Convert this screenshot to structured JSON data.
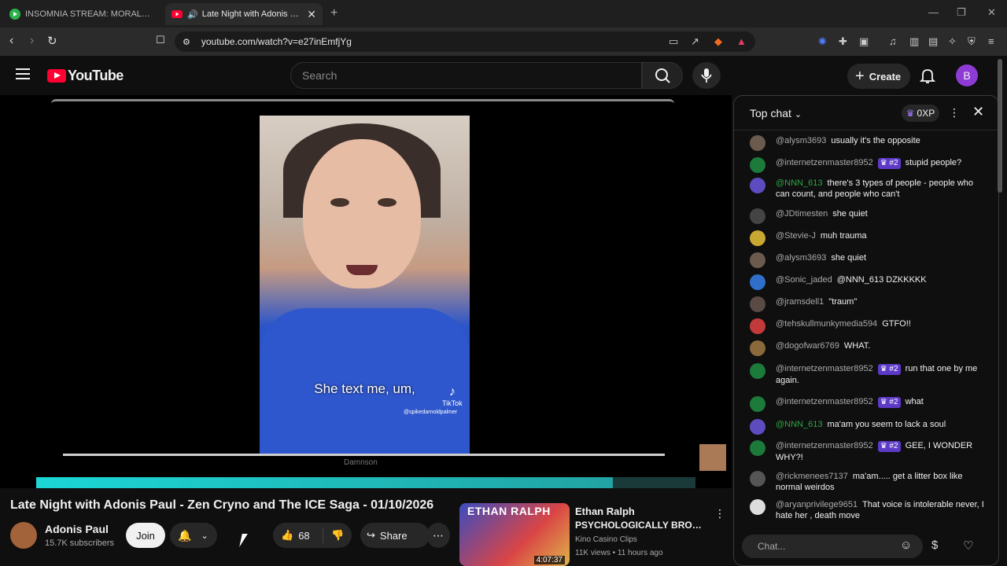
{
  "browser": {
    "tabs": [
      {
        "title": "INSOMNIA STREAM: MORALFAG ED",
        "active": false
      },
      {
        "title": "Late Night with Adonis Paul -",
        "active": true
      }
    ],
    "url": "youtube.com/watch?v=e27inEmfjYg",
    "new_tab_label": "+"
  },
  "youtube": {
    "logo_text": "YouTube",
    "search_placeholder": "Search",
    "create_label": "Create",
    "account_initial": "B"
  },
  "video": {
    "caption": "She text me, um,",
    "tiktok_label": "TikTok",
    "tiktok_handle": "@spikedarnoldpalmer",
    "overlay_text": "Damnson",
    "progress_fraction": 0.875,
    "title": "Late Night with Adonis Paul - Zen Cryno and The ICE Saga - 01/10/2026",
    "channel_name": "Adonis Paul",
    "subscribers": "15.7K subscribers",
    "join_label": "Join",
    "like_count": "68",
    "share_label": "Share"
  },
  "recommended": {
    "thumb_text": "ETHAN RALPH",
    "duration": "4:07:37",
    "channel": "Ethan Ralph",
    "title": "PSYCHOLOGICALLY BROKEN ...",
    "source": "Kino Casino Clips",
    "meta": "11K views • 11 hours ago"
  },
  "chat": {
    "title": "Top chat",
    "xp": "0XP",
    "input_placeholder": "Chat...",
    "messages": [
      {
        "author": "@alysm3693",
        "text": "usually it's the opposite",
        "member": false,
        "badge": ""
      },
      {
        "author": "@internetzenmaster8952",
        "text": "stupid people?",
        "member": false,
        "badge": "#2"
      },
      {
        "author": "@NNN_613",
        "text": "there's 3 types of people - people who can count, and people who can't",
        "member": true,
        "badge": ""
      },
      {
        "author": "@JDtimesten",
        "text": "she quiet",
        "member": false,
        "badge": ""
      },
      {
        "author": "@Stevie-J",
        "text": "muh trauma",
        "member": false,
        "badge": ""
      },
      {
        "author": "@alysm3693",
        "text": "she quiet",
        "member": false,
        "badge": ""
      },
      {
        "author": "@Sonic_jaded",
        "text": "@NNN_613 DZKKKKK",
        "member": false,
        "badge": ""
      },
      {
        "author": "@jramsdell1",
        "text": "\"traum\"",
        "member": false,
        "badge": ""
      },
      {
        "author": "@tehskullmunkymedia594",
        "text": "GTFO!!",
        "member": false,
        "badge": ""
      },
      {
        "author": "@dogofwar6769",
        "text": "WHAT.",
        "member": false,
        "badge": ""
      },
      {
        "author": "@internetzenmaster8952",
        "text": "run that one by me again.",
        "member": false,
        "badge": "#2"
      },
      {
        "author": "@internetzenmaster8952",
        "text": "what",
        "member": false,
        "badge": "#2"
      },
      {
        "author": "@NNN_613",
        "text": "ma'am you seem to lack a soul",
        "member": true,
        "badge": ""
      },
      {
        "author": "@internetzenmaster8952",
        "text": "GEE, I WONDER WHY?!",
        "member": false,
        "badge": "#2"
      },
      {
        "author": "@rickmenees7137",
        "text": "ma'am..... get a litter box like normal weirdos",
        "member": false,
        "badge": ""
      },
      {
        "author": "@aryanprivilege9651",
        "text": "That voice is intolerable never, I hate her , death move",
        "member": false,
        "badge": ""
      }
    ]
  },
  "colors": {
    "accent": "#ff0033",
    "progress": "#1cd6d6",
    "member_name": "#2ba640",
    "badge": "#5c3ac7"
  }
}
